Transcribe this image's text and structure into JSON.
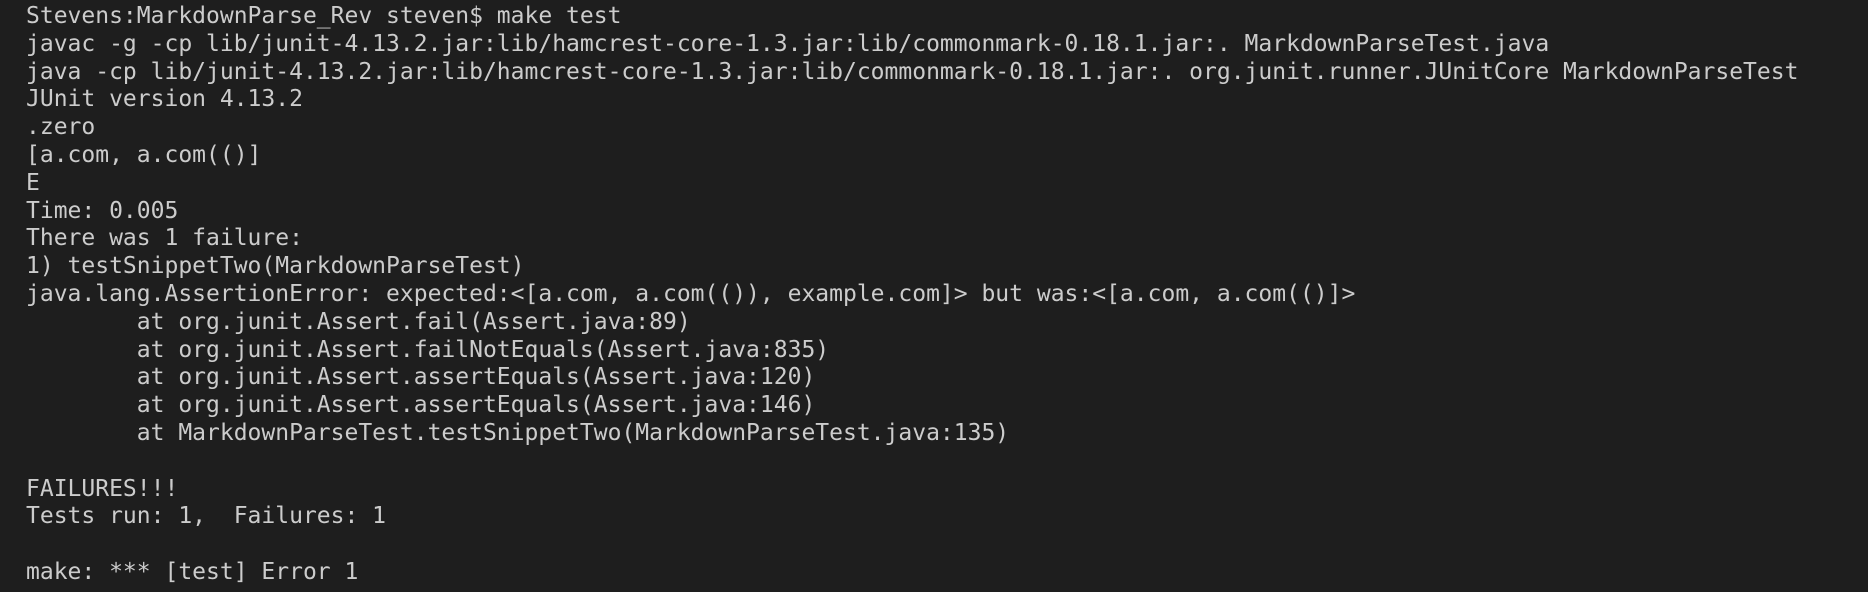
{
  "terminal": {
    "lines": [
      "Stevens:MarkdownParse_Rev steven$ make test",
      "javac -g -cp lib/junit-4.13.2.jar:lib/hamcrest-core-1.3.jar:lib/commonmark-0.18.1.jar:. MarkdownParseTest.java",
      "java -cp lib/junit-4.13.2.jar:lib/hamcrest-core-1.3.jar:lib/commonmark-0.18.1.jar:. org.junit.runner.JUnitCore MarkdownParseTest",
      "JUnit version 4.13.2",
      ".zero",
      "[a.com, a.com(()]",
      "E",
      "Time: 0.005",
      "There was 1 failure:",
      "1) testSnippetTwo(MarkdownParseTest)",
      "java.lang.AssertionError: expected:<[a.com, a.com(()), example.com]> but was:<[a.com, a.com(()]>",
      "        at org.junit.Assert.fail(Assert.java:89)",
      "        at org.junit.Assert.failNotEquals(Assert.java:835)",
      "        at org.junit.Assert.assertEquals(Assert.java:120)",
      "        at org.junit.Assert.assertEquals(Assert.java:146)",
      "        at MarkdownParseTest.testSnippetTwo(MarkdownParseTest.java:135)",
      "",
      "FAILURES!!!",
      "Tests run: 1,  Failures: 1",
      "",
      "make: *** [test] Error 1"
    ]
  }
}
